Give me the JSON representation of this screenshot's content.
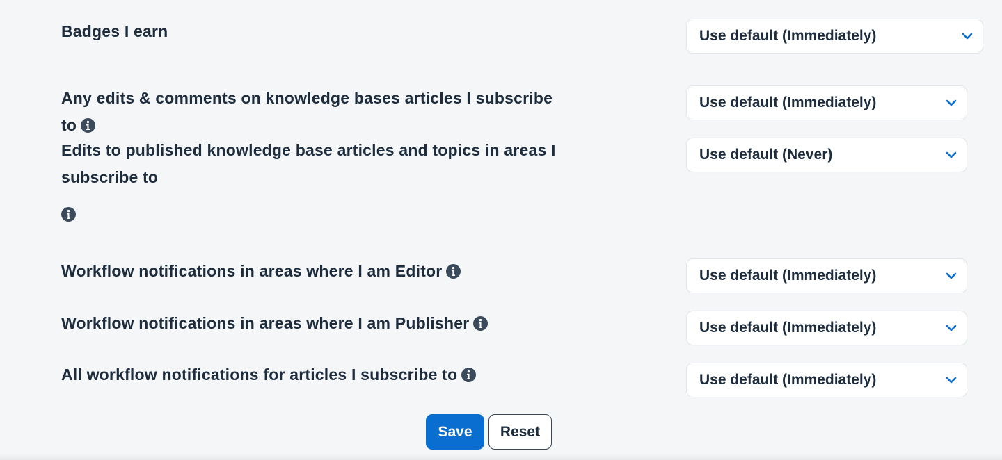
{
  "settings": [
    {
      "label": "Badges I earn",
      "value": "Use default (Immediately)",
      "info": false
    },
    {
      "label": "Any edits & comments on knowledge bases articles I subscribe to",
      "value": "Use default (Immediately)",
      "info": true
    },
    {
      "label": "Edits to published knowledge base articles and topics in areas I subscribe to",
      "value": "Use default (Never)",
      "info": true
    },
    {
      "label": "Workflow notifications in areas where I am Editor",
      "value": "Use default (Immediately)",
      "info": true
    },
    {
      "label": "Workflow notifications in areas where I am Publisher",
      "value": "Use default (Immediately)",
      "info": true
    },
    {
      "label": "All workflow notifications for articles I subscribe to",
      "value": "Use default (Immediately)",
      "info": true
    }
  ],
  "actions": {
    "save_label": "Save",
    "reset_label": "Reset"
  },
  "colors": {
    "accent": "#0a6ed1",
    "text": "#1d2d3e",
    "background": "#f5f6f7"
  }
}
